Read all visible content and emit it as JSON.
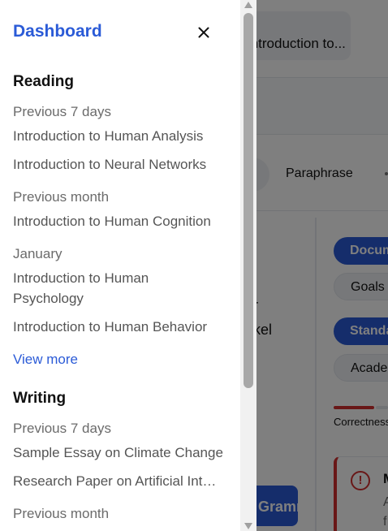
{
  "background": {
    "doc_title": "Introduction to...",
    "mode_label": "Paraphrase",
    "left_text_1": "r",
    "left_text_2": "kel",
    "chip_1": "Document",
    "chip_2": "Goals",
    "chip_3": "Standard",
    "chip_4": "Academic",
    "correctness_label": "Correctness",
    "card_title": "M",
    "card_line_1": "A",
    "card_line_2": "f",
    "grammar_button": "Grammar"
  },
  "drawer": {
    "title": "Dashboard",
    "close_icon": "close-icon",
    "reading": {
      "title": "Reading",
      "groups": [
        {
          "label": "Previous 7 days",
          "items": [
            "Introduction to Human Analysis",
            "Introduction to Neural Networks"
          ]
        },
        {
          "label": "Previous month",
          "items": [
            "Introduction to Human Cognition"
          ]
        },
        {
          "label": "January",
          "items": [
            "Introduction to Human Psychology",
            "Introduction to Human Behavior"
          ]
        }
      ],
      "view_more": "View more"
    },
    "writing": {
      "title": "Writing",
      "groups": [
        {
          "label": "Previous 7 days",
          "items": [
            "Sample Essay on Climate Change",
            "Research Paper on Artificial Intelligence"
          ]
        },
        {
          "label": "Previous month",
          "items": []
        }
      ]
    }
  },
  "colors": {
    "accent": "#2b5bd7",
    "error": "#d32f2f",
    "overlay": "rgba(0,0,0,0.5)"
  }
}
